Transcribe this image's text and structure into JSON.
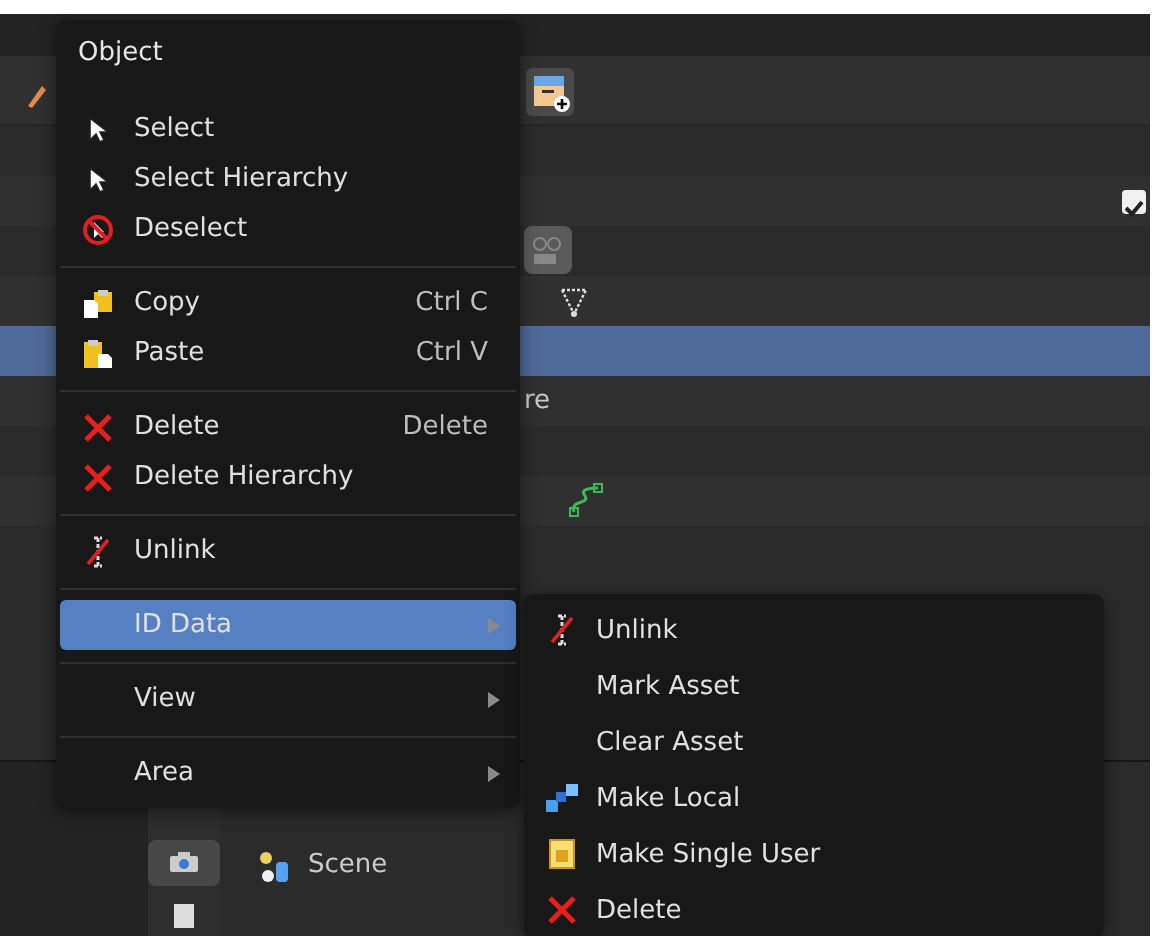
{
  "outliner": {
    "rows": [
      {
        "kind": "header",
        "selected": false
      },
      {
        "kind": "plain",
        "selected": false
      },
      {
        "kind": "collection",
        "checked": true,
        "selected": false
      },
      {
        "kind": "camera",
        "selected": false
      },
      {
        "kind": "mesh",
        "selected": false
      },
      {
        "kind": "plain",
        "selected": true
      },
      {
        "kind": "text",
        "label": "re",
        "selected": false
      },
      {
        "kind": "plain",
        "selected": false
      },
      {
        "kind": "curve",
        "selected": false
      },
      {
        "kind": "plain",
        "selected": false
      }
    ]
  },
  "properties": {
    "tabs": [
      {
        "selected": true
      },
      {
        "selected": false
      }
    ],
    "context": "Scene"
  },
  "context_menu": {
    "title": "Object",
    "items": [
      {
        "kind": "action",
        "label": "Select",
        "selected": false
      },
      {
        "kind": "action",
        "label": "Select Hierarchy",
        "selected": false
      },
      {
        "kind": "action",
        "label": "Deselect",
        "selected": false
      },
      {
        "kind": "separator"
      },
      {
        "kind": "action",
        "label": "Copy",
        "shortcut": "Ctrl C",
        "selected": false
      },
      {
        "kind": "action",
        "label": "Paste",
        "shortcut": "Ctrl V",
        "selected": false
      },
      {
        "kind": "separator"
      },
      {
        "kind": "action",
        "label": "Delete",
        "shortcut": "Delete",
        "selected": false
      },
      {
        "kind": "action",
        "label": "Delete Hierarchy",
        "selected": false
      },
      {
        "kind": "separator"
      },
      {
        "kind": "action",
        "label": "Unlink",
        "selected": false
      },
      {
        "kind": "separator"
      },
      {
        "kind": "submenu",
        "label": "ID Data",
        "selected": true
      },
      {
        "kind": "separator"
      },
      {
        "kind": "submenu",
        "label": "View",
        "selected": false
      },
      {
        "kind": "separator"
      },
      {
        "kind": "submenu",
        "label": "Area",
        "selected": false
      }
    ]
  },
  "submenu": {
    "items": [
      {
        "label": "Unlink",
        "selected": false
      },
      {
        "label": "Mark Asset",
        "selected": false
      },
      {
        "label": "Clear Asset",
        "selected": false
      },
      {
        "label": "Make Local",
        "selected": false
      },
      {
        "label": "Make Single User",
        "selected": false
      },
      {
        "label": "Delete",
        "selected": false
      }
    ]
  }
}
